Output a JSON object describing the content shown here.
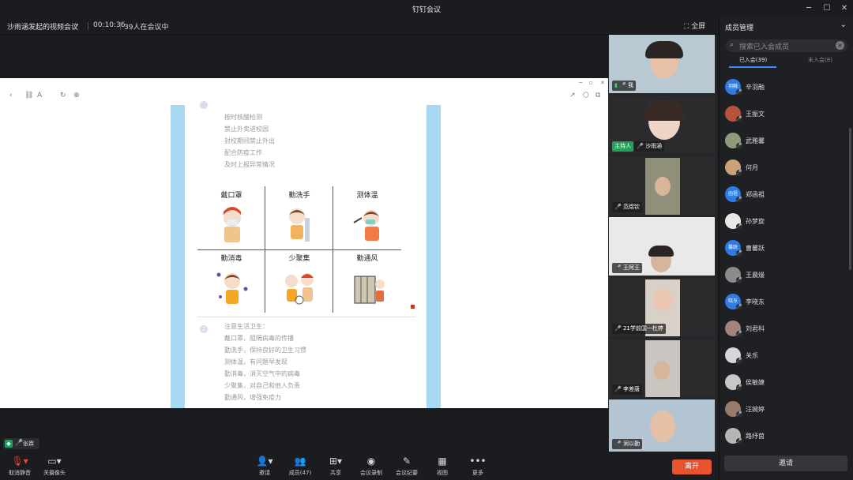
{
  "window": {
    "title": "钉钉会议"
  },
  "meeting": {
    "name": "沙雨涵发起的视频会议",
    "timer": "00:10:36",
    "count": "39人在会议中",
    "fullscreen": "全屏"
  },
  "document": {
    "list1": [
      "按时核酸检测",
      "禁止外卖进校园",
      "封校期间禁止外出",
      "配合防疫工作",
      "及时上报异常情况"
    ],
    "grid": [
      "戴口罩",
      "勤洗手",
      "测体温",
      "勤消毒",
      "少聚集",
      "勤通风"
    ],
    "num2": "2",
    "list2": [
      "注意生活卫生：",
      "戴口罩，阻隔病毒的传播",
      "勤洗手，保持良好的卫生习惯",
      "测体温，有问题早发现",
      "勤消毒，消灭空气中的病毒",
      "少聚集，对自己和他人负责",
      "勤通风，增强免疫力"
    ]
  },
  "tiles": [
    {
      "name": "我"
    },
    {
      "host": "主持人",
      "name": "沙雨涵"
    },
    {
      "name": "范煜钦"
    },
    {
      "name": "王阿王"
    },
    {
      "name": "21学前国一杜婷"
    },
    {
      "name": "李差唐"
    },
    {
      "name": "涧以勤"
    }
  ],
  "panel": {
    "title": "成员管理",
    "search_placeholder": "搜索已入会成员",
    "tab_joined": "已入会(39)",
    "tab_notjoined": "未入会(8)",
    "members": [
      {
        "name": "辛羽融",
        "avatar": "羽融",
        "color": "#2d7be5"
      },
      {
        "name": "王振文",
        "avatar": "",
        "color": "#b7533d"
      },
      {
        "name": "武雅馨",
        "avatar": "",
        "color": "#8f9a7a"
      },
      {
        "name": "何月",
        "avatar": "",
        "color": "#c9a27a"
      },
      {
        "name": "郑函祖",
        "avatar": "函祖",
        "color": "#2d7be5"
      },
      {
        "name": "孙梦旋",
        "avatar": "",
        "color": "#e9e9e9"
      },
      {
        "name": "曹馨跃",
        "avatar": "馨跃",
        "color": "#2d7be5"
      },
      {
        "name": "王晨熳",
        "avatar": "",
        "color": "#8b8b8b"
      },
      {
        "name": "李晓东",
        "avatar": "晓东",
        "color": "#2d7be5"
      },
      {
        "name": "刘君科",
        "avatar": "",
        "color": "#a0837a"
      },
      {
        "name": "关乐",
        "avatar": "",
        "color": "#d6d6d6"
      },
      {
        "name": "侯敏婕",
        "avatar": "",
        "color": "#c7c7c7"
      },
      {
        "name": "汪婉婷",
        "avatar": "",
        "color": "#9a7a6a"
      },
      {
        "name": "路纾茵",
        "avatar": "",
        "color": "#b5b5b5"
      }
    ],
    "invite": "邀请"
  },
  "speaker": {
    "name": "张霖"
  },
  "toolbar": {
    "mute": "取消静音",
    "camera": "关摄像头",
    "invite": "邀请",
    "members": "成员(47)",
    "share": "共享",
    "record": "会议录制",
    "minutes": "会议纪要",
    "view": "视图",
    "more": "更多",
    "end": "离开"
  }
}
